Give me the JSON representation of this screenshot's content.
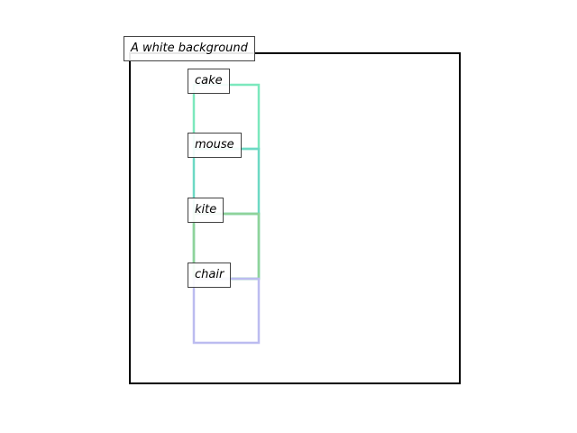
{
  "scene": {
    "caption": "A white background",
    "frame_color": "#000000"
  },
  "objects": [
    {
      "label": "cake",
      "color": "#7ce8bd"
    },
    {
      "label": "mouse",
      "color": "#6dd9c4"
    },
    {
      "label": "kite",
      "color": "#5fcdb8"
    },
    {
      "label": "chair",
      "color": "#8fd39a"
    },
    {
      "label": "",
      "color": "#bcbcf0"
    }
  ]
}
